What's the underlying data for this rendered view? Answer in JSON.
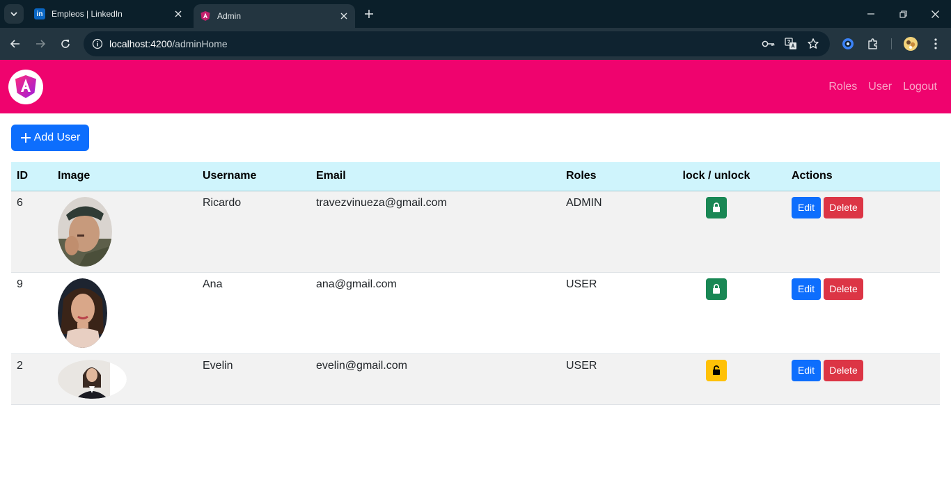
{
  "browser": {
    "tabs": [
      {
        "title": "Empleos | LinkedIn",
        "icon": "linkedin-icon",
        "active": false
      },
      {
        "title": "Admin",
        "icon": "angular-icon",
        "active": true
      }
    ],
    "url_host": "localhost:4200",
    "url_path": "/adminHome"
  },
  "navbar": {
    "links": [
      "Roles",
      "User",
      "Logout"
    ],
    "color": "#ef036e"
  },
  "add_user_label": "Add User",
  "table": {
    "headers": [
      "ID",
      "Image",
      "Username",
      "Email",
      "Roles",
      "lock / unlock",
      "Actions"
    ],
    "rows": [
      {
        "id": "6",
        "username": "Ricardo",
        "email": "travezvinueza@gmail.com",
        "role": "ADMIN",
        "locked": true
      },
      {
        "id": "9",
        "username": "Ana",
        "email": "ana@gmail.com",
        "role": "USER",
        "locked": true
      },
      {
        "id": "2",
        "username": "Evelin",
        "email": "evelin@gmail.com",
        "role": "USER",
        "locked": false
      }
    ],
    "edit_label": "Edit",
    "delete_label": "Delete"
  }
}
